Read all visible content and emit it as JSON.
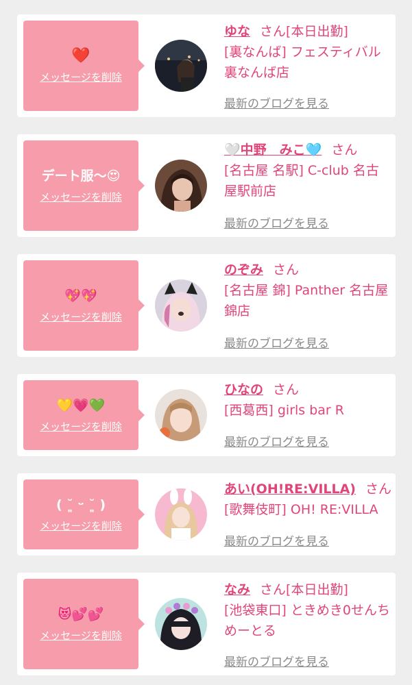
{
  "entries": [
    {
      "message": "❤️",
      "delete_label": "メッセージを削除",
      "name": "ゆな",
      "honorific": "さん",
      "badge": "[本日出勤]",
      "shop": "[裏なんば] フェスティバル裏なんば店",
      "blog_label": "最新のブログを見る"
    },
    {
      "message": "デート服〜😍",
      "delete_label": "メッセージを削除",
      "name": "🤍中野　みこ🩵",
      "honorific": "さん",
      "badge": "",
      "shop": "[名古屋 名駅] C-club 名古屋駅前店",
      "blog_label": "最新のブログを見る"
    },
    {
      "message": "💖💖",
      "delete_label": "メッセージを削除",
      "name": "のぞみ",
      "honorific": "さん",
      "badge": "",
      "shop": "[名古屋 錦] Panther 名古屋錦店",
      "blog_label": "最新のブログを見る"
    },
    {
      "message": "💛💗💚",
      "delete_label": "メッセージを削除",
      "name": "ひなの",
      "honorific": "さん",
      "badge": "",
      "shop": "[西葛西] girls bar R",
      "blog_label": "最新のブログを見る"
    },
    {
      "message": "( ˘͈ ᵕ ˘͈ )",
      "delete_label": "メッセージを削除",
      "name": "あい(OH!RE:VILLA)",
      "honorific": "さん",
      "badge": "",
      "shop": "[歌舞伎町] OH! RE:VILLA",
      "blog_label": "最新のブログを見る"
    },
    {
      "message": "😻💕💕",
      "delete_label": "メッセージを削除",
      "name": "なみ",
      "honorific": "さん",
      "badge": "[本日出勤]",
      "shop": "[池袋東口] ときめき0せんちめーとる",
      "blog_label": "最新のブログを見る"
    }
  ],
  "colors": {
    "accent": "#e0457a",
    "bubble": "#f79cab",
    "card": "#ffffff",
    "background": "#eeeeee",
    "link_gray": "#8a8a8a"
  }
}
